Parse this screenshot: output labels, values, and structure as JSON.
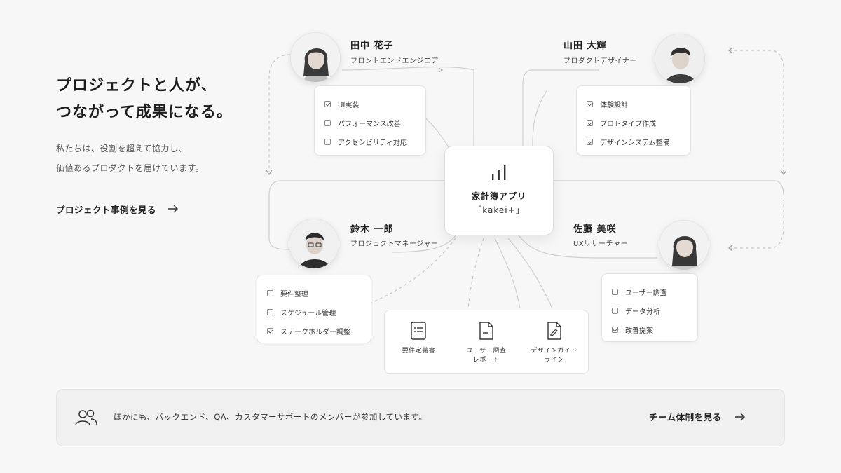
{
  "hero": {
    "title_line1": "プロジェクトと人が、",
    "title_line2": "つながって成果になる。",
    "desc_line1": "私たちは、役割を超えて協力し、",
    "desc_line2": "価値あるプロダクトを届けています。",
    "cta_label": "プロジェクト事例を見る"
  },
  "project": {
    "name": "家計簿アプリ",
    "subtitle": "「kakei+」",
    "icon": "bar-chart-icon"
  },
  "members": [
    {
      "name": "田中 花子",
      "role": "フロントエンドエンジニア",
      "tasks": [
        {
          "label": "UI実装",
          "checked": true
        },
        {
          "label": "パフォーマンス改善",
          "checked": false
        },
        {
          "label": "アクセシビリティ対応",
          "checked": false
        }
      ]
    },
    {
      "name": "山田 大輝",
      "role": "プロダクトデザイナー",
      "tasks": [
        {
          "label": "体験設計",
          "checked": true
        },
        {
          "label": "プロトタイプ作成",
          "checked": true
        },
        {
          "label": "デザインシステム整備",
          "checked": true
        }
      ]
    },
    {
      "name": "鈴木 一郎",
      "role": "プロジェクトマネージャー",
      "tasks": [
        {
          "label": "要件整理",
          "checked": false
        },
        {
          "label": "スケジュール管理",
          "checked": false
        },
        {
          "label": "ステークホルダー調整",
          "checked": true
        }
      ]
    },
    {
      "name": "佐藤 美咲",
      "role": "UXリサーチャー",
      "tasks": [
        {
          "label": "ユーザー調査",
          "checked": false
        },
        {
          "label": "データ分析",
          "checked": false
        },
        {
          "label": "改善提案",
          "checked": true
        }
      ]
    }
  ],
  "documents": [
    {
      "label": "要件定義書",
      "icon": "requirements-doc-icon"
    },
    {
      "label": "ユーザー調査\nレポート",
      "icon": "report-doc-icon"
    },
    {
      "label": "デザインガイド\nライン",
      "icon": "guideline-doc-icon"
    }
  ],
  "bottom": {
    "icon": "team-icon",
    "text": "ほかにも、バックエンド、QA、カスタマーサポートのメンバーが参加しています。",
    "cta_label": "チーム体制を見る"
  },
  "colors": {
    "background": "#f7f7f7",
    "card": "#ffffff",
    "border": "#e2e2e2",
    "text": "#222222",
    "connector": "#b5b5b5"
  }
}
